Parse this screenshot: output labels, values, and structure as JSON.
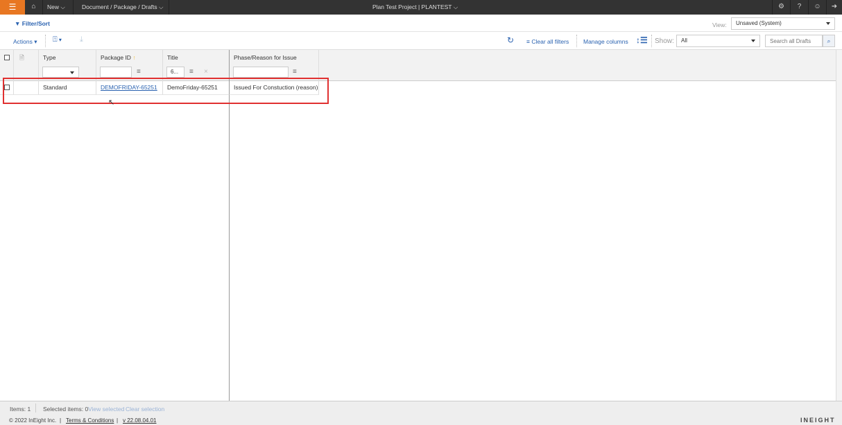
{
  "topbar": {
    "new_label": "New",
    "breadcrumb": "Document / Package / Drafts",
    "project": "Plan Test Project | PLANTEST"
  },
  "filter_sort": "Filter/Sort",
  "view": {
    "label": "View:",
    "value": "Unsaved (System)"
  },
  "toolbar": {
    "actions": "Actions",
    "clear_filters": "Clear all filters",
    "manage_columns": "Manage columns",
    "show_label": "Show:",
    "show_value": "All",
    "search_placeholder": "Search all Drafts"
  },
  "grid": {
    "columns": [
      "Type",
      "Package ID",
      "Title",
      "Phase/Reason for Issue"
    ],
    "filters": {
      "title": "6..."
    },
    "rows": [
      {
        "type": "Standard",
        "package_id": "DEMOFRIDAY-65251",
        "title": "DemoFriday-65251",
        "phase": "Issued For Constuction (reason)"
      }
    ]
  },
  "status": {
    "items": "Items: 1",
    "selected": "Selected items: 0",
    "view_selected": "View selected",
    "clear_selection": "Clear selection"
  },
  "footer": {
    "copyright": "© 2022 InEight Inc.",
    "terms": "Terms & Conditions",
    "version": "v 22.08.04.01",
    "brand": "INEIGHT"
  }
}
